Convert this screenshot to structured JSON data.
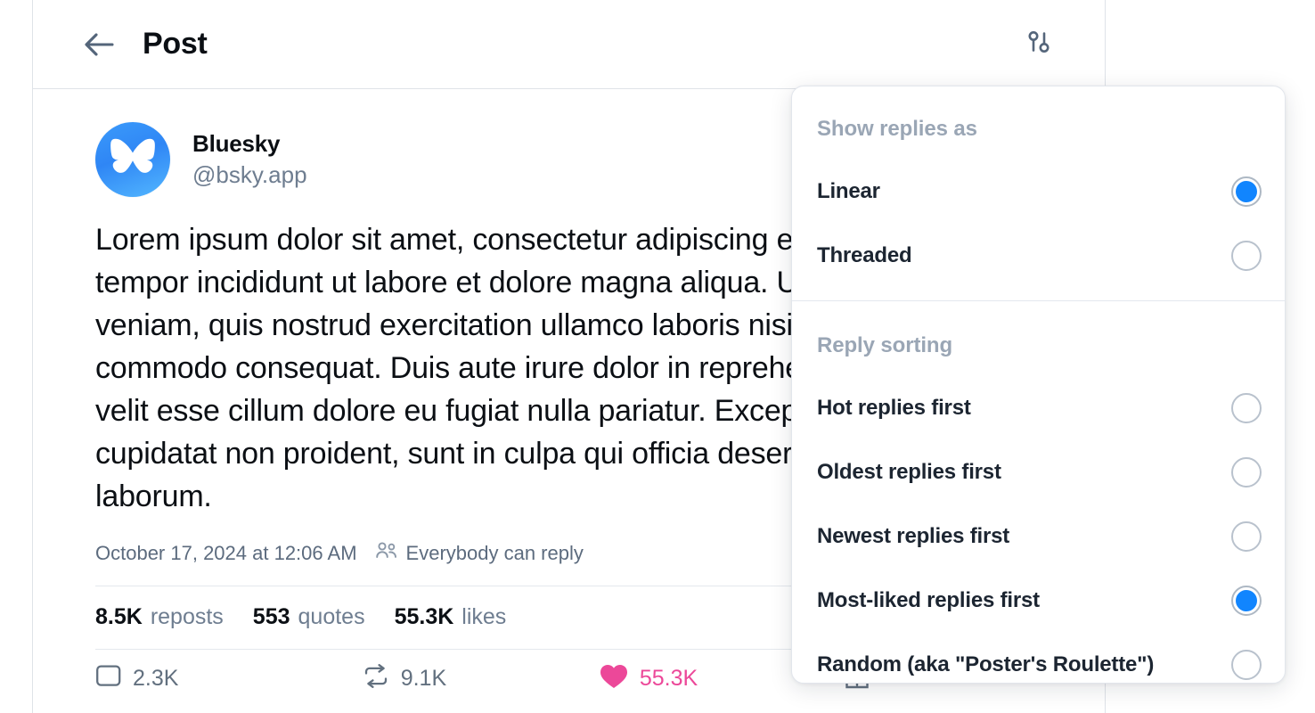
{
  "header": {
    "back_icon": "arrow-left-icon",
    "title": "Post",
    "settings_icon": "sliders-icon"
  },
  "post": {
    "avatar_icon": "bluesky-butterfly-icon",
    "author_name": "Bluesky",
    "author_handle": "@bsky.app",
    "text": "Lorem ipsum dolor sit amet, consectetur adipiscing elit, sed do eiusmod tempor incididunt ut labore et dolore magna aliqua. Ut enim ad minim veniam, quis nostrud exercitation ullamco laboris nisi ut aliquip ex ea commodo consequat. Duis aute irure dolor in reprehenderit in voluptate velit esse cillum dolore eu fugiat nulla pariatur. Excepteur sint occaecat cupidatat non proident, sunt in culpa qui officia deserunt mollit anim id est laborum.",
    "timestamp": "October 17, 2024 at 12:06 AM",
    "reply_permission_icon": "people-icon",
    "reply_permission": "Everybody can reply",
    "stats": [
      {
        "num": "8.5K",
        "label": "reposts"
      },
      {
        "num": "553",
        "label": "quotes"
      },
      {
        "num": "55.3K",
        "label": "likes"
      }
    ],
    "actions": [
      {
        "icon": "reply-icon",
        "count": "2.3K",
        "state": "default"
      },
      {
        "icon": "repost-icon",
        "count": "9.1K",
        "state": "default"
      },
      {
        "icon": "heart-icon",
        "count": "55.3K",
        "state": "liked"
      },
      {
        "icon": "share-icon",
        "count": "",
        "state": "default"
      },
      {
        "icon": "more-horizontal-icon",
        "count": "",
        "state": "default"
      }
    ]
  },
  "panel": {
    "section1_title": "Show replies as",
    "section1_items": [
      {
        "label": "Linear",
        "selected": true
      },
      {
        "label": "Threaded",
        "selected": false
      }
    ],
    "section2_title": "Reply sorting",
    "section2_items": [
      {
        "label": "Hot replies first",
        "selected": false
      },
      {
        "label": "Oldest replies first",
        "selected": false
      },
      {
        "label": "Newest replies first",
        "selected": false
      },
      {
        "label": "Most-liked replies first",
        "selected": true
      },
      {
        "label": "Random (aka \"Poster's Roulette\")",
        "selected": false
      }
    ]
  },
  "colors": {
    "accent_blue": "#1185fe",
    "like_pink": "#ec4899",
    "muted_text": "#6e7d90",
    "icon_gray": "#62707f"
  }
}
